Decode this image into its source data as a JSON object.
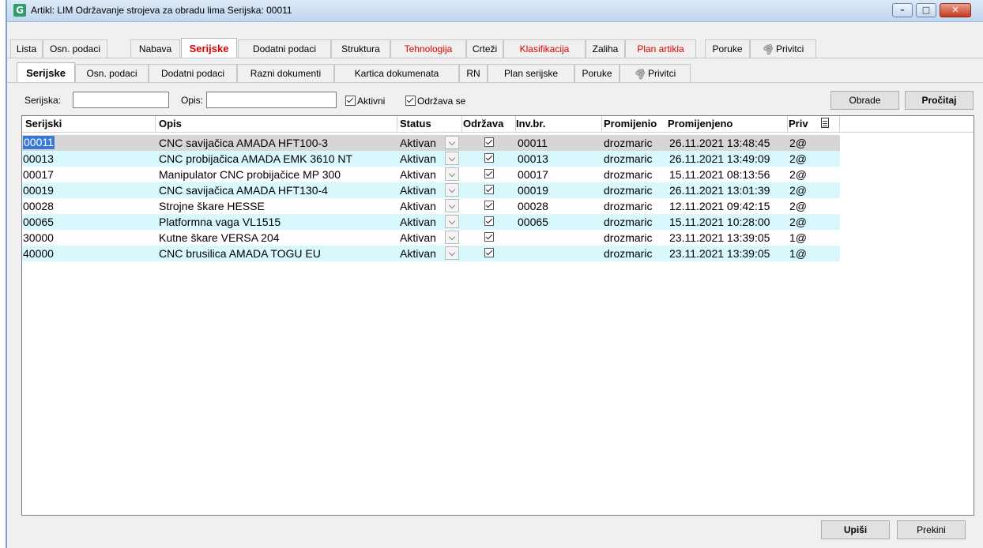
{
  "window": {
    "title": "Artikl: LIM Održavanje strojeva za obradu lima Serijska:  00011",
    "icon_letter": "G"
  },
  "main_tabs": [
    {
      "label": "Lista"
    },
    {
      "label": "Osn. podaci"
    },
    {
      "label": "Nabava"
    },
    {
      "label": "Serijske"
    },
    {
      "label": "Dodatni podaci"
    },
    {
      "label": "Struktura"
    },
    {
      "label": "Tehnologija"
    },
    {
      "label": "Crteži"
    },
    {
      "label": "Klasifikacija"
    },
    {
      "label": "Zaliha"
    },
    {
      "label": "Plan artikla"
    },
    {
      "label": "Poruke"
    },
    {
      "label": "Privitci"
    }
  ],
  "sub_tabs": [
    {
      "label": "Serijske"
    },
    {
      "label": "Osn. podaci"
    },
    {
      "label": "Dodatni podaci"
    },
    {
      "label": "Razni dokumenti"
    },
    {
      "label": "Kartica dokumenata"
    },
    {
      "label": "RN"
    },
    {
      "label": "Plan serijske"
    },
    {
      "label": "Poruke"
    },
    {
      "label": "Privitci"
    }
  ],
  "filters": {
    "serijska_label": "Serijska:",
    "serijska_value": "",
    "opis_label": "Opis:",
    "opis_value": "",
    "aktivni_label": "Aktivni",
    "aktivni_checked": true,
    "odrzava_label": "Održava se",
    "odrzava_checked": true
  },
  "buttons": {
    "obrade": "Obrade",
    "procitaj": "Pročitaj",
    "upisi": "Upiši",
    "prekini": "Prekini"
  },
  "grid": {
    "headers": {
      "serijski": "Serijski",
      "opis": "Opis",
      "status": "Status",
      "odrzava": "Održava",
      "invbr": "Inv.br.",
      "promijenio": "Promijenio",
      "promijenjeno": "Promijenjeno",
      "priv": "Priv"
    },
    "rows": [
      {
        "serijski": "00011",
        "opis": "CNC savijačica AMADA HFT100-3",
        "status": "Aktivan",
        "odrzava": true,
        "invbr": "00011",
        "promijenio": "drozmaric",
        "promijenjeno": "26.11.2021 13:48:45",
        "priv": "2@"
      },
      {
        "serijski": "00013",
        "opis": "CNC probijačica AMADA EMK 3610 NT",
        "status": "Aktivan",
        "odrzava": true,
        "invbr": "00013",
        "promijenio": "drozmaric",
        "promijenjeno": "26.11.2021 13:49:09",
        "priv": "2@"
      },
      {
        "serijski": "00017",
        "opis": "Manipulator CNC probijačice MP 300",
        "status": "Aktivan",
        "odrzava": true,
        "invbr": "00017",
        "promijenio": "drozmaric",
        "promijenjeno": "15.11.2021 08:13:56",
        "priv": "2@"
      },
      {
        "serijski": "00019",
        "opis": "CNC savijačica AMADA HFT130-4",
        "status": "Aktivan",
        "odrzava": true,
        "invbr": "00019",
        "promijenio": "drozmaric",
        "promijenjeno": "26.11.2021 13:01:39",
        "priv": "2@"
      },
      {
        "serijski": "00028",
        "opis": "Strojne škare HESSE",
        "status": "Aktivan",
        "odrzava": true,
        "invbr": "00028",
        "promijenio": "drozmaric",
        "promijenjeno": "12.11.2021 09:42:15",
        "priv": "2@"
      },
      {
        "serijski": "00065",
        "opis": "Platformna vaga VL1515",
        "status": "Aktivan",
        "odrzava": true,
        "invbr": "00065",
        "promijenio": "drozmaric",
        "promijenjeno": "15.11.2021 10:28:00",
        "priv": "2@"
      },
      {
        "serijski": "30000",
        "opis": "Kutne škare VERSA 204",
        "status": "Aktivan",
        "odrzava": true,
        "invbr": "",
        "promijenio": "drozmaric",
        "promijenjeno": "23.11.2021 13:39:05",
        "priv": "1@"
      },
      {
        "serijski": "40000",
        "opis": "CNC brusilica AMADA TOGU EU",
        "status": "Aktivan",
        "odrzava": true,
        "invbr": "",
        "promijenio": "drozmaric",
        "promijenjeno": "23.11.2021 13:39:05",
        "priv": "1@"
      }
    ]
  }
}
